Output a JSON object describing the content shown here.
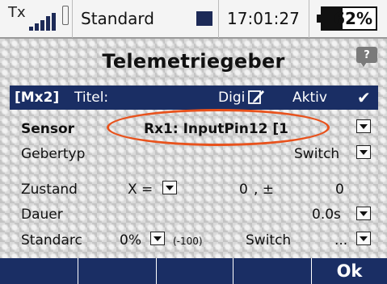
{
  "statusbar": {
    "tx_label": "Tx",
    "model": "Standard",
    "time": "17:01:27",
    "battery": "62%",
    "battery_level": 0.62
  },
  "page": {
    "title": "Telemetriegeber",
    "help_icon": "?"
  },
  "header": {
    "id": "[Mx2]",
    "title_label": "Titel:",
    "title_value": "Digi",
    "active_label": "Aktiv",
    "active_check": "✔"
  },
  "rows": {
    "sensor": {
      "label": "Sensor",
      "value": "Rx1: InputPin12 [1"
    },
    "gebertyp": {
      "label": "Gebertyp",
      "value": "Switch"
    },
    "zustand": {
      "label": "Zustand",
      "op": "X =",
      "value1": "0",
      "sep": ", ±",
      "value2": "0"
    },
    "dauer": {
      "label": "Dauer",
      "value": "0.0s"
    },
    "standard": {
      "label": "Standarc",
      "percent": "0%",
      "hint": "(-100)",
      "switch_label": "Switch",
      "switch_value": "..."
    }
  },
  "softkeys": [
    "",
    "",
    "",
    "",
    "Ok"
  ],
  "colors": {
    "accent": "#1a2e64",
    "highlight_oval": "#e8521c"
  },
  "icons": [
    "signal-bars-icon",
    "antenna-icon",
    "help-icon",
    "edit-pencil-icon",
    "check-icon",
    "dropdown-arrow-icon"
  ]
}
